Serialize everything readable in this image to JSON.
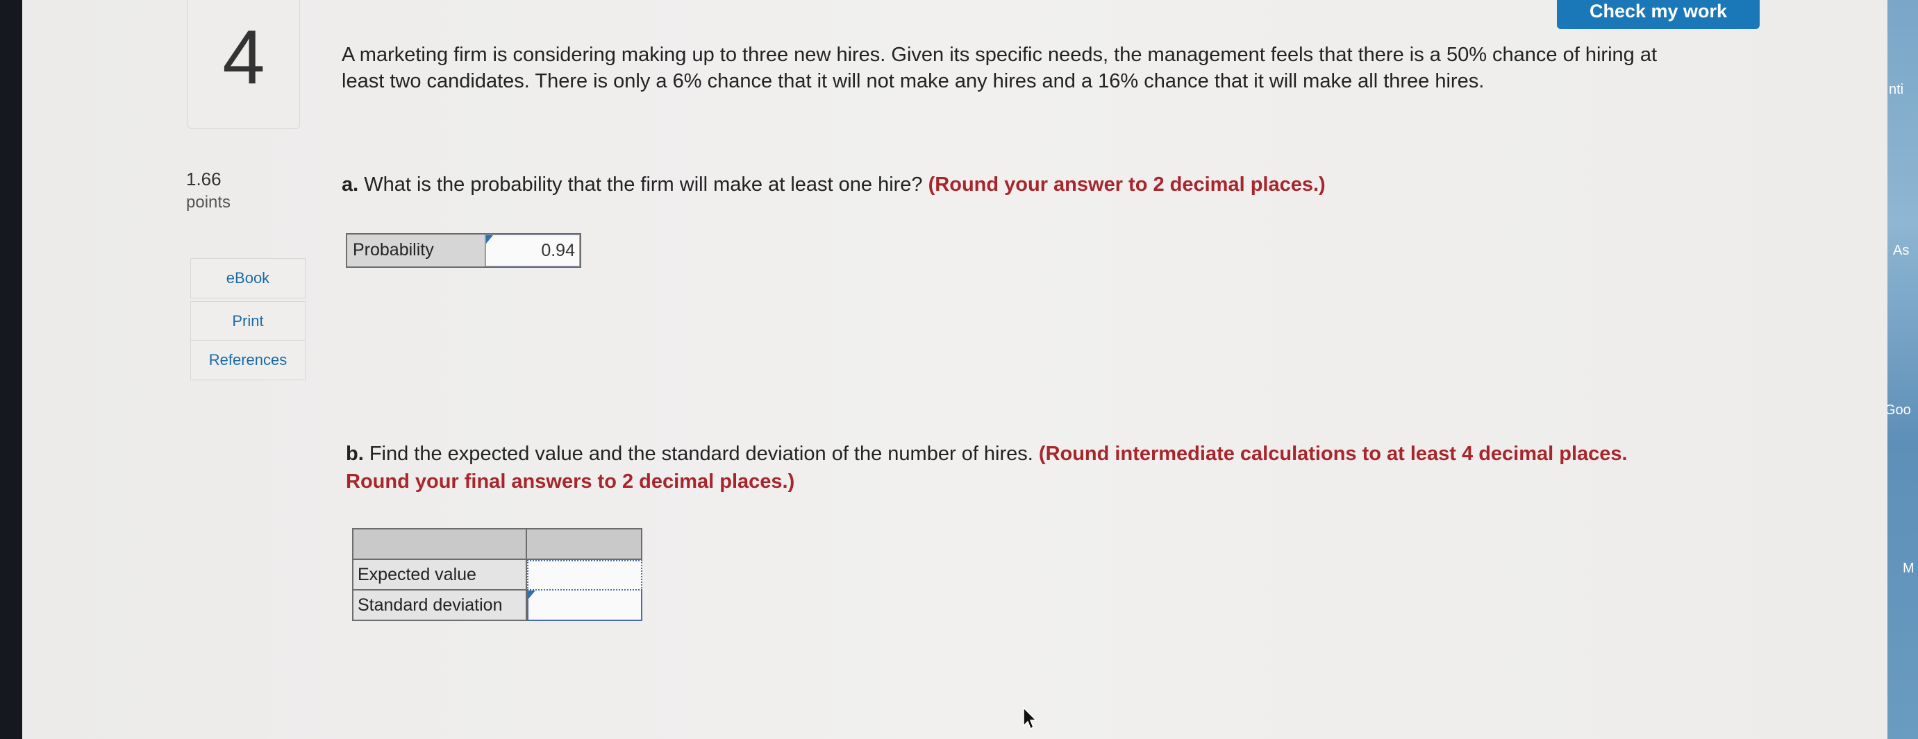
{
  "header": {
    "check_button": "Check my work"
  },
  "question": {
    "number": "4",
    "points_value": "1.66",
    "points_label": "points",
    "intro": "A marketing firm is considering making up to three new hires. Given its specific needs, the management feels that there is a 50% chance of hiring at least two candidates. There is only a 6% chance that it will not make any hires and a 16% chance that it will make all three hires."
  },
  "sidebar": {
    "ebook": "eBook",
    "print": "Print",
    "references": "References"
  },
  "part_a": {
    "label": "a.",
    "text": " What is the probability that the firm will make at least one hire? ",
    "instruction": "(Round your answer to 2 decimal places.)",
    "row_label": "Probability",
    "answer": "0.94"
  },
  "part_b": {
    "label": "b.",
    "text": " Find the expected value and the standard deviation of the number of hires. ",
    "instruction": "(Round intermediate calculations to at least 4 decimal places. Round your final answers to 2 decimal places.)",
    "rows": [
      {
        "label": "Expected value",
        "value": ""
      },
      {
        "label": "Standard deviation",
        "value": ""
      }
    ]
  },
  "background_tabs": [
    "nti",
    "As",
    "Goo",
    "M"
  ]
}
